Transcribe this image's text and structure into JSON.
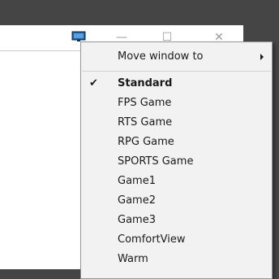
{
  "titlebar": {
    "minimize_glyph": "—",
    "maximize_glyph": "☐",
    "close_glyph": "✕",
    "app_icon": "monitor-icon"
  },
  "context_menu": {
    "move_window_label": "Move window to",
    "submenu_arrow": "chevron-right-icon",
    "checked_item": "Standard",
    "items": [
      "Standard",
      "FPS Game",
      "RTS Game",
      "RPG Game",
      "SPORTS Game",
      "Game1",
      "Game2",
      "Game3",
      "ComfortView",
      "Warm"
    ]
  },
  "colors": {
    "desktop": "#454545",
    "menu_bg": "#f2f2f2",
    "window_bg": "#ffffff",
    "icon_blue": "#1f5f9e"
  }
}
